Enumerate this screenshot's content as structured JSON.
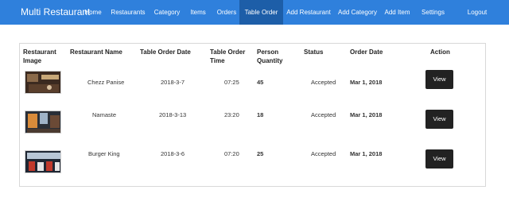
{
  "navbar": {
    "brand": "Multi Restaurant",
    "items": [
      {
        "label": "Home"
      },
      {
        "label": "Restaurants"
      },
      {
        "label": "Category"
      },
      {
        "label": "Items"
      },
      {
        "label": "Orders"
      },
      {
        "label": "Table Order",
        "active": true
      },
      {
        "label": "Add Restaurant"
      },
      {
        "label": "Add Category"
      },
      {
        "label": "Add Item"
      },
      {
        "label": "Settings"
      },
      {
        "label": "Logout"
      }
    ]
  },
  "table": {
    "headers": {
      "image": "Restaurant Image",
      "name": "Restaurant Name",
      "date": "Table Order Date",
      "time": "Table Order Time",
      "qty": "Person Quantity",
      "status": "Status",
      "order_date": "Order Date",
      "action": "Action"
    },
    "rows": [
      {
        "name": "Chezz Panise",
        "date": "2018-3-7",
        "time": "07:25",
        "qty": "45",
        "status": "Accepted",
        "order_date": "Mar 1, 2018",
        "action": "View"
      },
      {
        "name": "Namaste",
        "date": "2018-3-13",
        "time": "23:20",
        "qty": "18",
        "status": "Accepted",
        "order_date": "Mar 1, 2018",
        "action": "View"
      },
      {
        "name": "Burger King",
        "date": "2018-3-6",
        "time": "07:20",
        "qty": "25",
        "status": "Accepted",
        "order_date": "Mar 1, 2018",
        "action": "View"
      }
    ]
  }
}
